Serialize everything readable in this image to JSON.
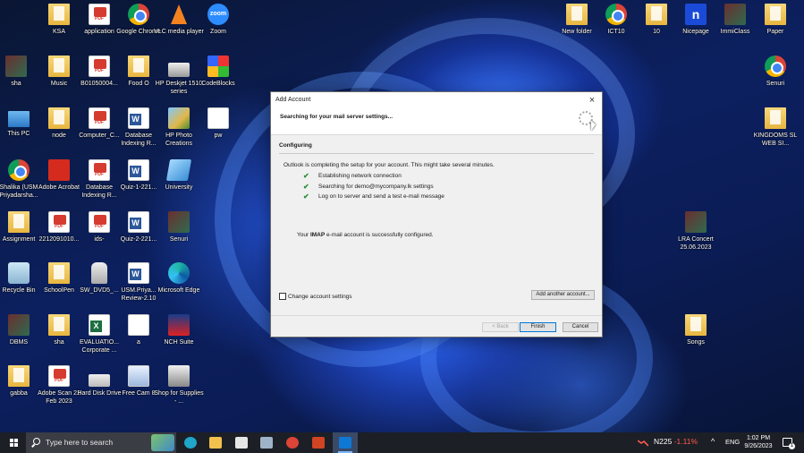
{
  "desktop": {
    "icons": [
      {
        "label": "KSA",
        "type": "folder"
      },
      {
        "label": "application",
        "type": "pdf"
      },
      {
        "label": "Google Chrome",
        "type": "chrome"
      },
      {
        "label": "VLC media player",
        "type": "vlc"
      },
      {
        "label": "Zoom",
        "type": "zoom",
        "glyph": "zoom"
      },
      {
        "label": "sha",
        "type": "image"
      },
      {
        "label": "Music",
        "type": "folder"
      },
      {
        "label": "B01050004...",
        "type": "pdf"
      },
      {
        "label": "Food O",
        "type": "folder"
      },
      {
        "label": "HP Deskjet 1510 series",
        "type": "hp"
      },
      {
        "label": "CodeBlocks",
        "type": "codeblocks"
      },
      {
        "label": "This PC",
        "type": "pc"
      },
      {
        "label": "node",
        "type": "folder"
      },
      {
        "label": "Computer_C...",
        "type": "pdf"
      },
      {
        "label": "Database Indexing R...",
        "type": "word"
      },
      {
        "label": "HP Photo Creations",
        "type": "photo"
      },
      {
        "label": "pw",
        "type": "generic"
      },
      {
        "label": "Shalika (USM Priyadarsha...",
        "type": "chrome"
      },
      {
        "label": "Adobe Acrobat",
        "type": "acrobat"
      },
      {
        "label": "Database Indexing R...",
        "type": "pdf"
      },
      {
        "label": "Quiz-1-221...",
        "type": "word"
      },
      {
        "label": "University",
        "type": "univ"
      },
      {
        "label": "Assignment",
        "type": "folder"
      },
      {
        "label": "2212091010...",
        "type": "pdf"
      },
      {
        "label": "ids-",
        "type": "pdf"
      },
      {
        "label": "Quiz-2-221...",
        "type": "word"
      },
      {
        "label": "Senuri",
        "type": "image"
      },
      {
        "label": "Recycle Bin",
        "type": "recycle"
      },
      {
        "label": "SchoolPen",
        "type": "folder"
      },
      {
        "label": "SW_DVD5_...",
        "type": "usb"
      },
      {
        "label": "USM.Priya... Review-2.10",
        "type": "word"
      },
      {
        "label": "Microsoft Edge",
        "type": "edge"
      },
      {
        "label": "DBMS",
        "type": "image"
      },
      {
        "label": "sha",
        "type": "folder"
      },
      {
        "label": "EVALUATIO... Corporate ...",
        "type": "excel"
      },
      {
        "label": "a",
        "type": "generic"
      },
      {
        "label": "NCH Suite",
        "type": "nch"
      },
      {
        "label": "gabba",
        "type": "folder"
      },
      {
        "label": "Adobe Scan 22 Feb 2023",
        "type": "pdf"
      },
      {
        "label": "Hard Disk Drive",
        "type": "disk"
      },
      {
        "label": "Free Cam 8",
        "type": "cam"
      },
      {
        "label": "Shop for Supplies - ...",
        "type": "shop"
      },
      {
        "label": "New folder",
        "type": "folder"
      },
      {
        "label": "ICT10",
        "type": "chrome"
      },
      {
        "label": "10",
        "type": "folder"
      },
      {
        "label": "Nicepage",
        "type": "nicepage",
        "glyph": "n"
      },
      {
        "label": "ImmiClass",
        "type": "image"
      },
      {
        "label": "Paper",
        "type": "folder"
      },
      {
        "label": "Senuri",
        "type": "chrome"
      },
      {
        "label": "KINGDOMS SL WEB SI...",
        "type": "folder"
      },
      {
        "label": "LRA Concert 25.06.2023",
        "type": "image"
      },
      {
        "label": "Songs",
        "type": "folder"
      }
    ]
  },
  "dialog": {
    "title": "Add Account",
    "close_glyph": "×",
    "subtitle": "Searching for your mail server settings...",
    "section": "Configuring",
    "description": "Outlook is completing the setup for your account. This might take several minutes.",
    "check_glyph": "✔",
    "tasks": [
      "Establishing network connection",
      "Searching for demo@mycompany.lk settings",
      "Log on to server and send a test e-mail message"
    ],
    "result_prefix": "Your ",
    "result_bold": "IMAP",
    "result_suffix": " e-mail account is successfully configured.",
    "checkbox_label": "Change account settings",
    "checkbox_checked": false,
    "add_another_label": "Add another account...",
    "back_label": "< Back",
    "finish_label": "Finish",
    "cancel_label": "Cancel"
  },
  "taskbar": {
    "search_placeholder": "Type here to search",
    "apps": [
      {
        "name": "task-view",
        "color": "#e6e6e6",
        "active": false
      },
      {
        "name": "edge",
        "color": "#1fa6c9",
        "active": false
      },
      {
        "name": "file-explorer",
        "color": "#f2c14e",
        "active": false
      },
      {
        "name": "microsoft-store",
        "color": "#e6e6e6",
        "active": false
      },
      {
        "name": "snipping",
        "color": "#9fb3c8",
        "active": false
      },
      {
        "name": "chrome",
        "color": "#db4437",
        "active": false
      },
      {
        "name": "powerpoint",
        "color": "#d04423",
        "active": false
      },
      {
        "name": "outlook",
        "color": "#0f78d4",
        "active": true
      }
    ],
    "stock_symbol": "N225",
    "stock_change": "-1.11%",
    "chevron": "^",
    "language": "ENG",
    "time": "1:02 PM",
    "date": "9/26/2023",
    "notification_count": "1"
  }
}
